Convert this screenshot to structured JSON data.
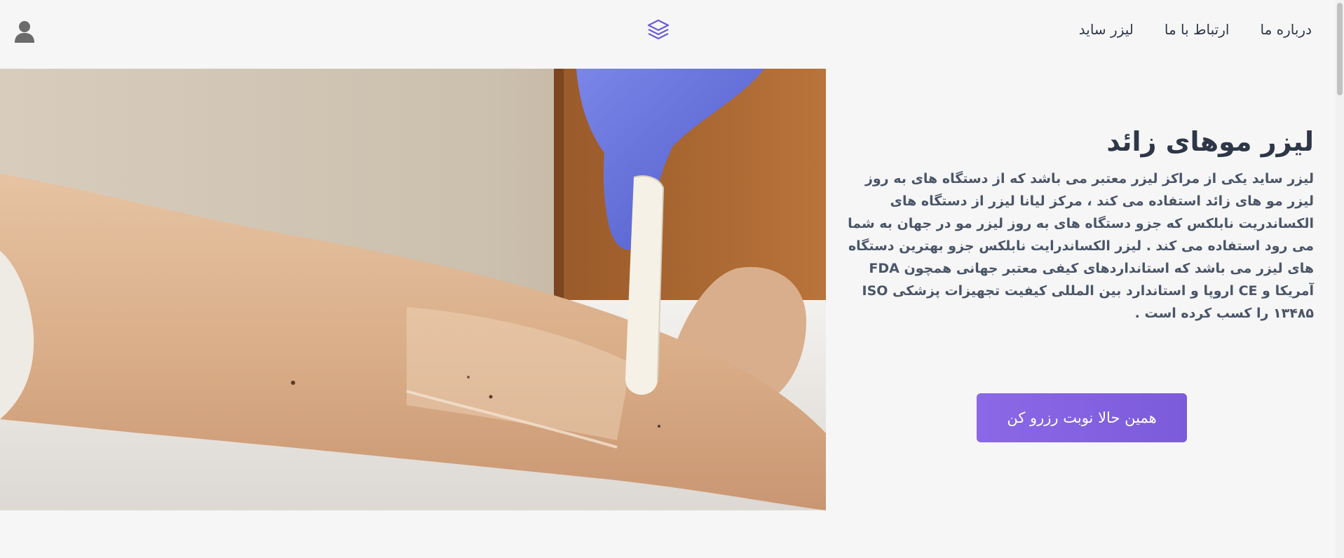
{
  "header": {
    "nav": [
      {
        "label": "لیزر ساید"
      },
      {
        "label": "ارتباط با ما"
      },
      {
        "label": "درباره ما"
      }
    ],
    "logo_icon": "layers-icon",
    "user_icon": "user-icon"
  },
  "hero": {
    "title": "لیزر موهای زائد",
    "description": "لیزر ساید یکی از مراکز لیزر معتبر می باشد که از دستگاه های به روز لیزر مو های زائد استفاده می کند ، مرکز لیانا لیزر از دستگاه های الکساندریت نابلکس که جزو دستگاه های به روز لیزر مو در جهان به شما می رود استفاده می کند . لیزر الکساندرایت نابلکس جزو بهترین دستگاه های لیزر می باشد که استانداردهای کیفی معتبر جهانی همچون FDA آمریکا و CE اروپا و استاندارد بین المللی کیفیت تجهیزات پزشکی ISO ۱۳۴۸۵ را کسب کرده است .",
    "cta_label": "همین حالا نوبت رزرو کن",
    "image_subject": "waxing-leg-photo"
  },
  "colors": {
    "accent": "#7c5bdb",
    "logo": "#6b5bd6",
    "heading": "#2d3748",
    "text": "#4a5568",
    "background": "#f6f6f6"
  }
}
